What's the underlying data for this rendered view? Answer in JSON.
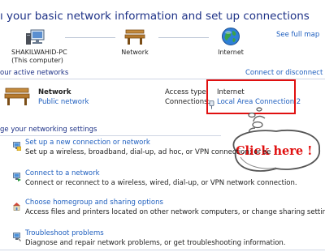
{
  "header": {
    "title": "ı your basic network information and set up connections",
    "see_full_map": "See full map"
  },
  "map": {
    "computer_name": "SHAKILWAHID-PC",
    "computer_sub": "(This computer)",
    "network_label": "Network",
    "internet_label": "Internet"
  },
  "active": {
    "section_label": "our active networks",
    "connect_disconnect": "Connect or disconnect",
    "network_name": "Network",
    "network_type": "Public network",
    "access_type_label": "Access type:",
    "access_type_value": "Internet",
    "connections_label": "Connections:",
    "connections_value": "Local Area Connection 2"
  },
  "annotation": {
    "callout_text": "Click here !",
    "highlight_color": "#e01010"
  },
  "settings": {
    "section_label": "ge your networking settings",
    "tasks": [
      {
        "title": "Set up a new connection or network",
        "desc": "Set up a wireless, broadband, dial-up, ad hoc, or VPN connection; or se",
        "icon": "new-connection-icon"
      },
      {
        "title": "Connect to a network",
        "desc": "Connect or reconnect to a wireless, wired, dial-up, or VPN network connection.",
        "icon": "connect-network-icon"
      },
      {
        "title": "Choose homegroup and sharing options",
        "desc": "Access files and printers located on other network computers, or change sharing settings.",
        "icon": "homegroup-icon"
      },
      {
        "title": "Troubleshoot problems",
        "desc": "Diagnose and repair network problems, or get troubleshooting information.",
        "icon": "troubleshoot-icon"
      }
    ]
  },
  "colors": {
    "title": "#1e3287",
    "link": "#1f5fbf",
    "callout_red": "#e01010"
  }
}
